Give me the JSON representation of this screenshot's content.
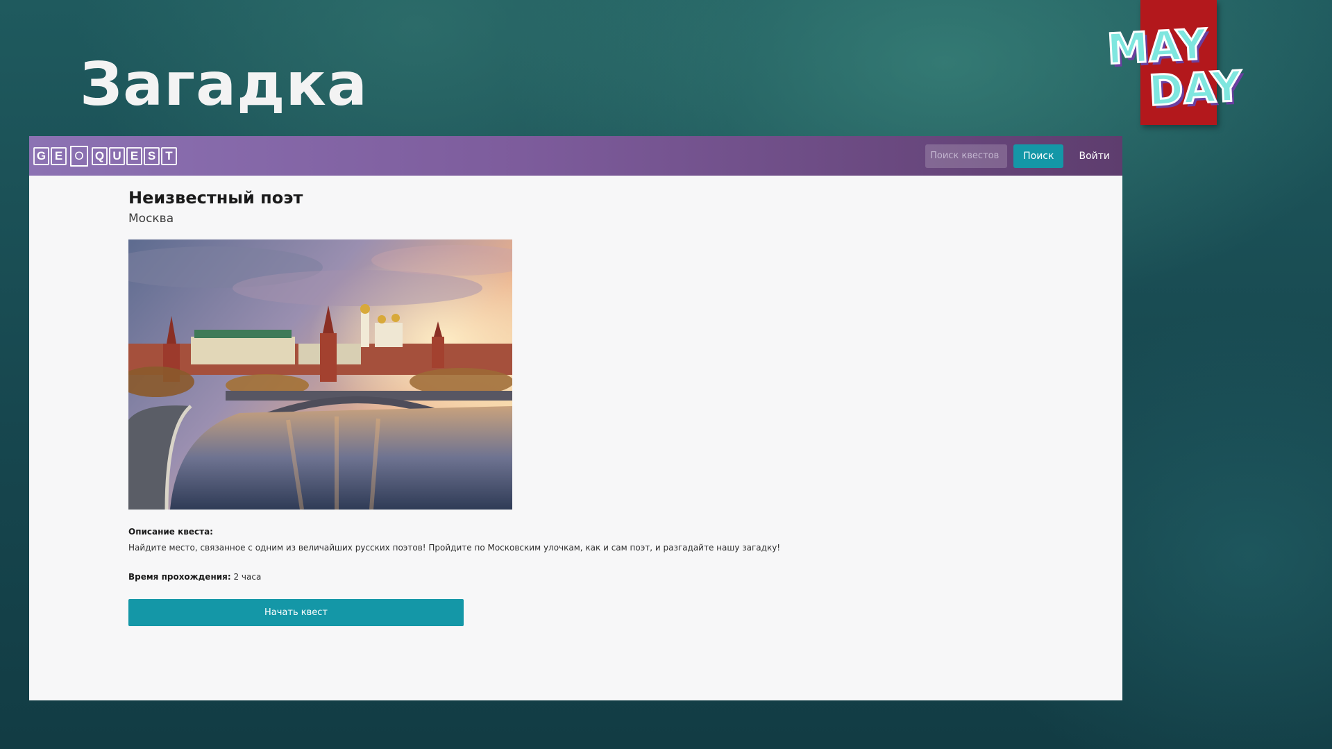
{
  "slide": {
    "title": "Загадка",
    "badge": {
      "line1": "MAY",
      "line2": "DAY",
      "background": "#b3181c",
      "text_color": "#7fe6df"
    }
  },
  "navbar": {
    "logo_letters": [
      "G",
      "E",
      "O",
      "Q",
      "U",
      "E",
      "S",
      "T"
    ],
    "search_placeholder": "Поиск квестов",
    "search_label": "Поиск",
    "login_label": "Войти",
    "gradient_start": "#8c72b3",
    "gradient_end": "#5e3d6e",
    "accent": "#1497a7"
  },
  "quest": {
    "title": "Неизвестный поэт",
    "city": "Москва",
    "image": "moscow-kremlin-river-photo",
    "description_label": "Описание квеста:",
    "description": "Найдите место, связанное с одним из величайших русских поэтов! Пройдите по Московским улочкам, как и сам поэт, и разгадайте нашу загадку!",
    "duration_label": "Время прохождения:",
    "duration_value": "2 часа",
    "start_label": "Начать квест"
  }
}
